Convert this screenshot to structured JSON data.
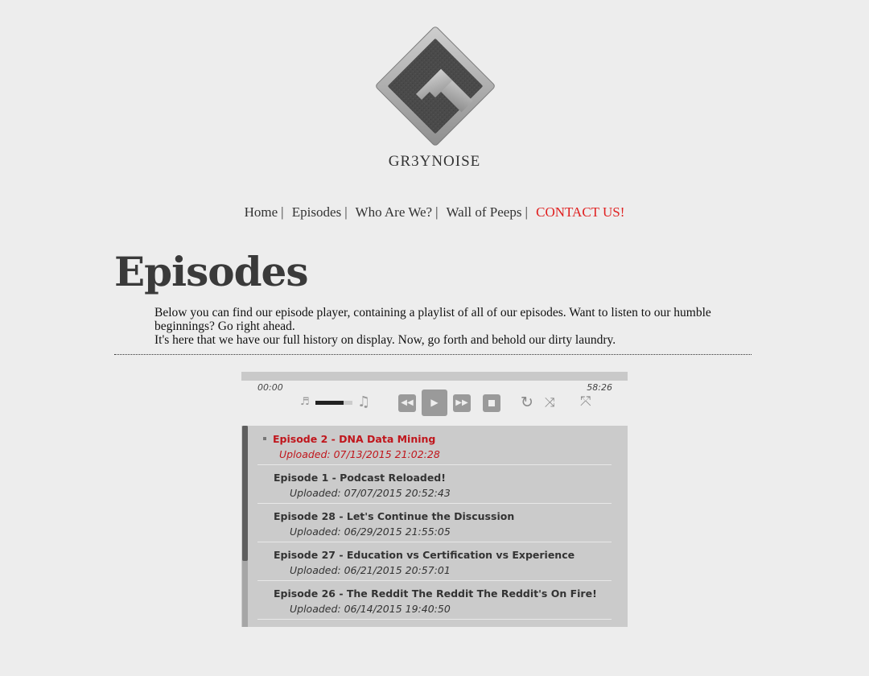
{
  "logo": {
    "text": "GR3YNOISE"
  },
  "nav": {
    "items": [
      "Home",
      "Episodes",
      "Who Are We?",
      "Wall of Peeps"
    ],
    "separator": "|",
    "contact": "CONTACT US!",
    "contact_color": "#e02020"
  },
  "page": {
    "title": "Episodes",
    "intro_line1": "Below you can find our episode player, containing a playlist of all of our episodes. Want to listen to our humble beginnings? Go right ahead.",
    "intro_line2": "It's here that we have our full history on display. Now, go forth and behold our dirty laundry."
  },
  "player": {
    "current_time": "00:00",
    "total_time": "58:26",
    "volume": 0.75,
    "icons": [
      "volume-low-icon",
      "volume-high-icon",
      "previous-icon",
      "play-icon",
      "next-icon",
      "stop-icon",
      "repeat-icon",
      "shuffle-icon",
      "fullscreen-icon"
    ],
    "glyphs": {
      "vol_low": "♬",
      "vol_high": "♫",
      "prev": "◀◀",
      "play": "▶",
      "next": "▶▶",
      "repeat": "↻",
      "shuffle": "⤨",
      "full": "⤧"
    }
  },
  "playlist": {
    "tracks": [
      {
        "title": "Episode 2 - DNA Data Mining",
        "uploaded": "Uploaded: 07/13/2015 21:02:28"
      },
      {
        "title": "Episode 1 - Podcast Reloaded!",
        "uploaded": "Uploaded: 07/07/2015 20:52:43"
      },
      {
        "title": "Episode 28 - Let's Continue the Discussion",
        "uploaded": "Uploaded: 06/29/2015 21:55:05"
      },
      {
        "title": "Episode 27 - Education vs Certification vs Experience",
        "uploaded": "Uploaded: 06/21/2015 20:57:01"
      },
      {
        "title": "Episode 26 - The Reddit The Reddit The Reddit's On Fire!",
        "uploaded": "Uploaded: 06/14/2015 19:40:50"
      }
    ],
    "active_color": "#c0161c"
  }
}
